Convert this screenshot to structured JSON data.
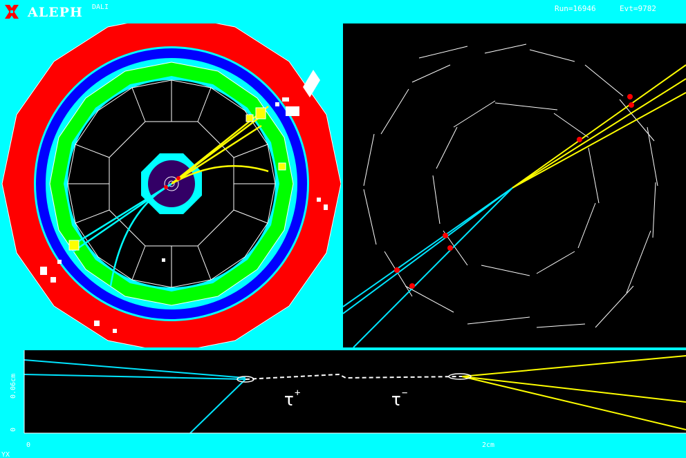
{
  "header": {
    "app_title": "ALEPH",
    "program": "DALI",
    "run": "Run=16946",
    "event": "Evt=9782"
  },
  "views": {
    "bottom": {
      "axis_y_label": "0.06cm",
      "y_zero": "0",
      "x_zero": "0",
      "x_scale": "2cm",
      "corner_label": "YX",
      "tau_plus": "τ",
      "tau_plus_sup": "+",
      "tau_minus": "τ",
      "tau_minus_sup": "−"
    }
  },
  "colors": {
    "background": "#00ffff",
    "calorimeter": "#ff0000",
    "coil": "#0000ff",
    "ecal": "#00ff00",
    "tpc": "#000000",
    "tau_plus_tracks": "#00e5ff",
    "tau_minus_tracks": "#ffff00",
    "hits": "#ff0000"
  }
}
